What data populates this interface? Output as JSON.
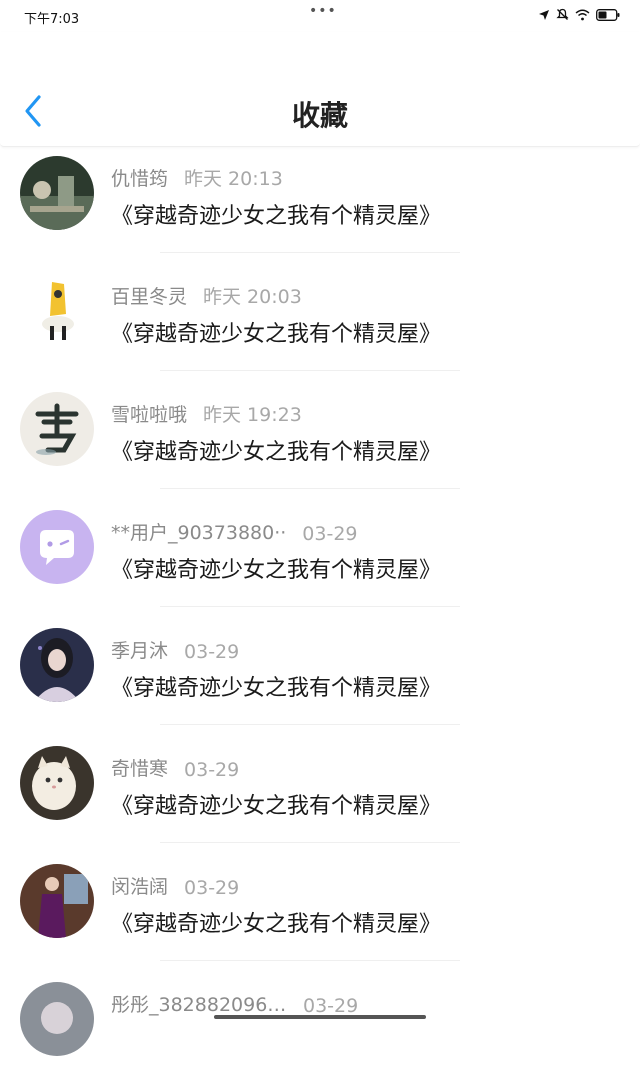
{
  "status_bar": {
    "time": "下午7:03",
    "dots": "•••"
  },
  "header": {
    "title": "收藏"
  },
  "items": [
    {
      "name": "仇惜筠",
      "time": "昨天 20:13",
      "book": "《穿越奇迹少女之我有个精灵屋》"
    },
    {
      "name": "百里冬灵",
      "time": "昨天 20:03",
      "book": "《穿越奇迹少女之我有个精灵屋》"
    },
    {
      "name": "雪啦啦哦",
      "time": "昨天 19:23",
      "book": "《穿越奇迹少女之我有个精灵屋》"
    },
    {
      "name": "**用户_90373880··",
      "time": "03-29",
      "book": "《穿越奇迹少女之我有个精灵屋》"
    },
    {
      "name": "季月沐",
      "time": "03-29",
      "book": "《穿越奇迹少女之我有个精灵屋》"
    },
    {
      "name": "奇惜寒",
      "time": "03-29",
      "book": "《穿越奇迹少女之我有个精灵屋》"
    },
    {
      "name": "闵浩阔",
      "time": "03-29",
      "book": "《穿越奇迹少女之我有个精灵屋》"
    },
    {
      "name": "彤彤_3828820964··",
      "time": "03-29",
      "book": ""
    }
  ],
  "colors": {
    "accent": "#2196f3",
    "meta_gray": "#8a8a8a",
    "title": "#222222"
  }
}
